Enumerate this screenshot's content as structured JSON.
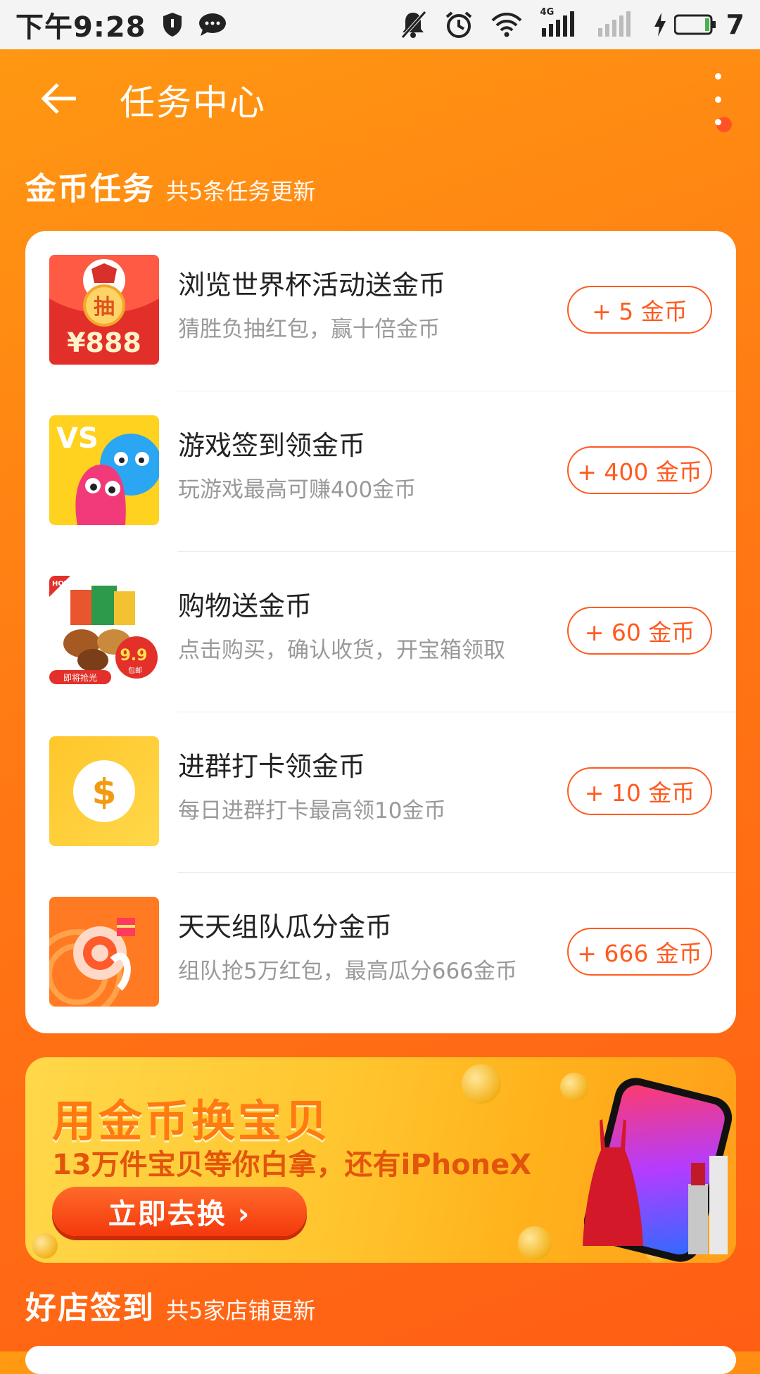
{
  "status_bar": {
    "time": "下午9:28",
    "network_label": "4G",
    "battery_number": "7",
    "icons_left": [
      "shield-icon",
      "message-icon"
    ],
    "icons_right": [
      "mute-icon",
      "alarm-icon",
      "wifi-icon",
      "signal-icon",
      "signal-icon-2",
      "charging-icon",
      "battery-icon"
    ]
  },
  "header": {
    "title": "任务中心"
  },
  "coin_section": {
    "title": "金币任务",
    "subtitle": "共5条任务更新"
  },
  "tasks": [
    {
      "title": "浏览世界杯活动送金币",
      "desc": "猜胜负抽红包，赢十倍金币",
      "reward": "+ 5 金币",
      "thumb_text_1": "抽",
      "thumb_text_2": "¥888"
    },
    {
      "title": "游戏签到领金币",
      "desc": "玩游戏最高可赚400金币",
      "reward": "+ 400 金币",
      "thumb_text_1": "VS"
    },
    {
      "title": "购物送金币",
      "desc": "点击购买，确认收货，开宝箱领取",
      "reward": "+ 60 金币",
      "thumb_text_1": "HOT",
      "thumb_text_2": "9.9",
      "thumb_text_3": "即将抢光",
      "thumb_text_4": "包邮"
    },
    {
      "title": "进群打卡领金币",
      "desc": "每日进群打卡最高领10金币",
      "reward": "+ 10 金币",
      "thumb_text_1": "$"
    },
    {
      "title": "天天组队瓜分金币",
      "desc": "组队抢5万红包，最高瓜分666金币",
      "reward": "+ 666 金币"
    }
  ],
  "banner": {
    "title": "用金币换宝贝",
    "subtitle": "13万件宝贝等你白拿，还有iPhoneX",
    "button": "立即去换 ›"
  },
  "shop_section": {
    "title": "好店签到",
    "subtitle": "共5家店铺更新"
  }
}
